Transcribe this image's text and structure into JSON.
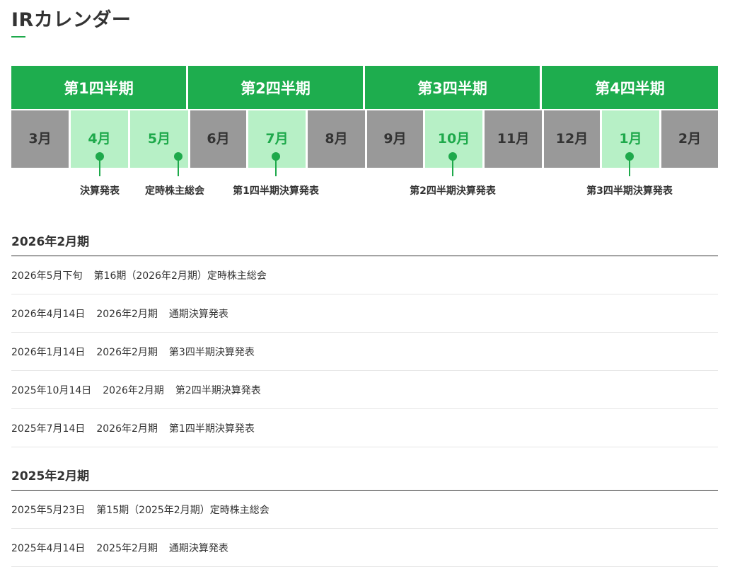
{
  "page": {
    "title": "IRカレンダー"
  },
  "calendar": {
    "quarters": [
      "第1四半期",
      "第2四半期",
      "第3四半期",
      "第4四半期"
    ],
    "months": [
      {
        "label": "3月",
        "highlighted": false
      },
      {
        "label": "4月",
        "highlighted": true
      },
      {
        "label": "5月",
        "highlighted": true
      },
      {
        "label": "6月",
        "highlighted": false
      },
      {
        "label": "7月",
        "highlighted": true
      },
      {
        "label": "8月",
        "highlighted": false
      },
      {
        "label": "9月",
        "highlighted": false
      },
      {
        "label": "10月",
        "highlighted": true
      },
      {
        "label": "11月",
        "highlighted": false
      },
      {
        "label": "12月",
        "highlighted": false
      },
      {
        "label": "1月",
        "highlighted": true
      },
      {
        "label": "2月",
        "highlighted": false
      }
    ],
    "events": [
      "決算発表",
      "定時株主総会",
      "第1四半期決算発表",
      "第2四半期決算発表",
      "第3四半期決算発表"
    ],
    "colors": {
      "accent": "#1ead4e",
      "highlight": "#b7f0c6",
      "inactive": "#999999"
    }
  },
  "sections": [
    {
      "heading": "2026年2月期",
      "rows": [
        {
          "date": "2026年5月下旬",
          "term": "第16期（2026年2月期）定時株主総会",
          "event": ""
        },
        {
          "date": "2026年4月14日",
          "term": "2026年2月期",
          "event": "通期決算発表"
        },
        {
          "date": "2026年1月14日",
          "term": "2026年2月期",
          "event": "第3四半期決算発表"
        },
        {
          "date": "2025年10月14日",
          "term": "2026年2月期",
          "event": "第2四半期決算発表"
        },
        {
          "date": "2025年7月14日",
          "term": "2026年2月期",
          "event": "第1四半期決算発表"
        }
      ]
    },
    {
      "heading": "2025年2月期",
      "rows": [
        {
          "date": "2025年5月23日",
          "term": "第15期（2025年2月期）定時株主総会",
          "event": ""
        },
        {
          "date": "2025年4月14日",
          "term": "2025年2月期",
          "event": "通期決算発表"
        }
      ]
    }
  ]
}
